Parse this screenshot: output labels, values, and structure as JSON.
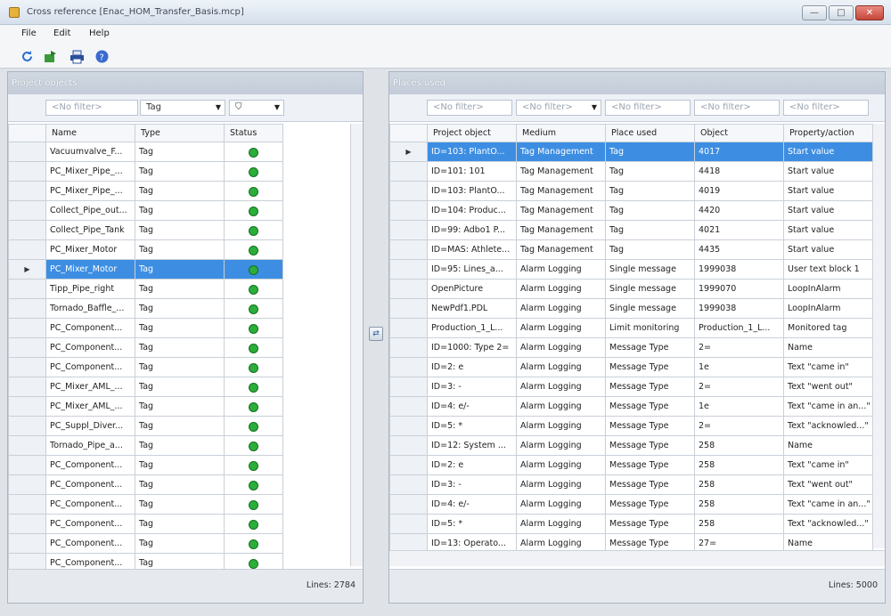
{
  "window": {
    "title": "Cross reference [Enac_HOM_Transfer_Basis.mcp]",
    "min": "—",
    "max": "□",
    "close": "✕"
  },
  "menu": [
    "File",
    "Edit",
    "Help"
  ],
  "toolbar": [
    {
      "icon": "refresh-icon",
      "color": "#2f6fd0"
    },
    {
      "icon": "export-icon",
      "color": "#3a9a3a"
    },
    {
      "icon": "print-icon",
      "color": "#2a4f9a"
    },
    {
      "icon": "help-icon",
      "color": "#3a6ad0"
    }
  ],
  "left_pane": {
    "title": "Project objects",
    "filters": [
      "<No filter>",
      "Tag",
      "▾"
    ],
    "columns": [
      "Name",
      "Type",
      "Status"
    ],
    "rows": [
      {
        "name": "Vacuumvalve_F...",
        "type": "Tag"
      },
      {
        "name": "PC_Mixer_Pipe_...",
        "type": "Tag"
      },
      {
        "name": "PC_Mixer_Pipe_...",
        "type": "Tag"
      },
      {
        "name": "Collect_Pipe_out...",
        "type": "Tag"
      },
      {
        "name": "Collect_Pipe_Tank",
        "type": "Tag"
      },
      {
        "name": "PC_Mixer_Motor",
        "type": "Tag"
      },
      {
        "name": "PC_Mixer_Motor",
        "type": "Tag",
        "selected": true
      },
      {
        "name": "Tipp_Pipe_right",
        "type": "Tag"
      },
      {
        "name": "Tornado_Baffle_...",
        "type": "Tag"
      },
      {
        "name": "PC_Component...",
        "type": "Tag"
      },
      {
        "name": "PC_Component...",
        "type": "Tag"
      },
      {
        "name": "PC_Component...",
        "type": "Tag"
      },
      {
        "name": "PC_Mixer_AML_...",
        "type": "Tag"
      },
      {
        "name": "PC_Mixer_AML_...",
        "type": "Tag"
      },
      {
        "name": "PC_Suppl_Diver...",
        "type": "Tag"
      },
      {
        "name": "Tornado_Pipe_a...",
        "type": "Tag"
      },
      {
        "name": "PC_Component...",
        "type": "Tag"
      },
      {
        "name": "PC_Component...",
        "type": "Tag"
      },
      {
        "name": "PC_Component...",
        "type": "Tag"
      },
      {
        "name": "PC_Component...",
        "type": "Tag"
      },
      {
        "name": "PC_Component...",
        "type": "Tag"
      },
      {
        "name": "PC_Component...",
        "type": "Tag"
      }
    ],
    "lines": "Lines: 2784"
  },
  "right_pane": {
    "title": "Places used",
    "filters": [
      "<No filter>",
      "<No filter>",
      "<No filter>",
      "<No filter>",
      "<No filter>"
    ],
    "columns": [
      "Project object",
      "Medium",
      "Place used",
      "Object",
      "Property/action"
    ],
    "rows": [
      [
        "ID=103: PlantO...",
        "Tag Management",
        "Tag",
        "4017",
        "Start value",
        true
      ],
      [
        "ID=101: 101",
        "Tag Management",
        "Tag",
        "4418",
        "Start value"
      ],
      [
        "ID=103: PlantO...",
        "Tag Management",
        "Tag",
        "4019",
        "Start value"
      ],
      [
        "ID=104: Produc...",
        "Tag Management",
        "Tag",
        "4420",
        "Start value"
      ],
      [
        "ID=99: Adbo1 P...",
        "Tag Management",
        "Tag",
        "4021",
        "Start value"
      ],
      [
        "ID=MAS: Athlete...",
        "Tag Management",
        "Tag",
        "4435",
        "Start value"
      ],
      [
        "ID=95: Lines_a...",
        "Alarm Logging",
        "Single message",
        "1999038",
        "User text block 1"
      ],
      [
        "OpenPicture",
        "Alarm Logging",
        "Single message",
        "1999070",
        "LoopInAlarm"
      ],
      [
        "NewPdf1.PDL",
        "Alarm Logging",
        "Single message",
        "1999038",
        "LoopInAlarm"
      ],
      [
        "Production_1_L...",
        "Alarm Logging",
        "Limit monitoring",
        "Production_1_L...",
        "Monitored tag"
      ],
      [
        "ID=1000: Type 2=",
        "Alarm Logging",
        "Message Type",
        "2=",
        "Name"
      ],
      [
        "ID=2: e",
        "Alarm Logging",
        "Message Type",
        "1e",
        "Text \"came in\""
      ],
      [
        "ID=3: -",
        "Alarm Logging",
        "Message Type",
        "2=",
        "Text \"went out\""
      ],
      [
        "ID=4: e/-",
        "Alarm Logging",
        "Message Type",
        "1e",
        "Text \"came in an...\""
      ],
      [
        "ID=5: *",
        "Alarm Logging",
        "Message Type",
        "2=",
        "Text \"acknowled...\""
      ],
      [
        "ID=12: System ...",
        "Alarm Logging",
        "Message Type",
        "258",
        "Name"
      ],
      [
        "ID=2: e",
        "Alarm Logging",
        "Message Type",
        "258",
        "Text \"came in\""
      ],
      [
        "ID=3: -",
        "Alarm Logging",
        "Message Type",
        "258",
        "Text \"went out\""
      ],
      [
        "ID=4: e/-",
        "Alarm Logging",
        "Message Type",
        "258",
        "Text \"came in an...\""
      ],
      [
        "ID=5: *",
        "Alarm Logging",
        "Message Type",
        "258",
        "Text \"acknowled...\""
      ],
      [
        "ID=13: Operato...",
        "Alarm Logging",
        "Message Type",
        "27=",
        "Name"
      ]
    ],
    "lines": "Lines: 5000"
  },
  "splitter_icon": "arrow-swap-icon"
}
